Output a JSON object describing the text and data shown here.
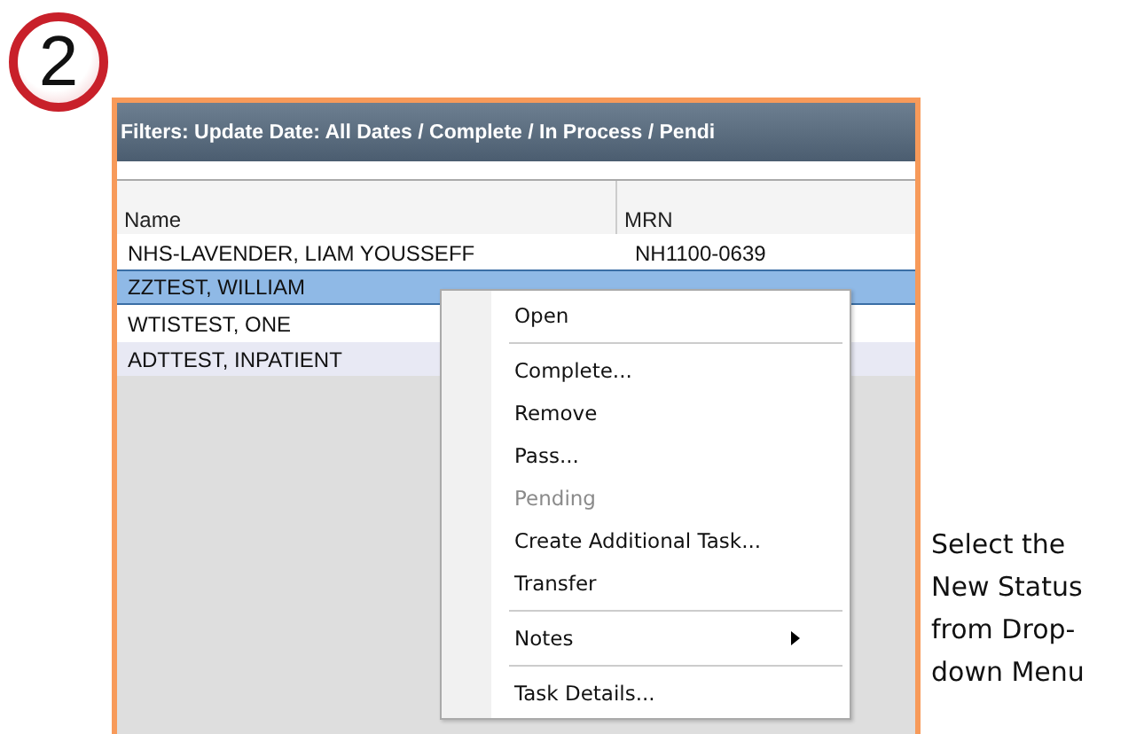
{
  "step_badge": "2",
  "filter_bar": {
    "text": "Filters: Update Date: All Dates / Complete / In Process / Pendi"
  },
  "table": {
    "columns": [
      "Name",
      "MRN"
    ],
    "rows": [
      {
        "name": "NHS-LAVENDER, LIAM YOUSSEFF",
        "mrn": "NH1100-0639",
        "selected": false
      },
      {
        "name": "ZZTEST, WILLIAM",
        "selected": true
      },
      {
        "name": "WTISTEST, ONE",
        "selected": false
      },
      {
        "name": "ADTTEST, INPATIENT",
        "selected": false
      }
    ]
  },
  "context_menu": {
    "items": [
      {
        "kind": "item",
        "label": "Open",
        "disabled": false
      },
      {
        "kind": "separator"
      },
      {
        "kind": "item",
        "label": "Complete...",
        "disabled": false
      },
      {
        "kind": "item",
        "label": "Remove",
        "disabled": false
      },
      {
        "kind": "item",
        "label": "Pass...",
        "disabled": false
      },
      {
        "kind": "item",
        "label": "Pending",
        "disabled": true
      },
      {
        "kind": "item",
        "label": "Create Additional Task...",
        "disabled": false
      },
      {
        "kind": "item",
        "label": "Transfer",
        "disabled": false
      },
      {
        "kind": "separator"
      },
      {
        "kind": "item",
        "label": "Notes",
        "disabled": false,
        "submenu": true
      },
      {
        "kind": "separator"
      },
      {
        "kind": "item",
        "label": "Task Details...",
        "disabled": false
      }
    ]
  },
  "caption": "Select the New Status from Drop-down Menu"
}
